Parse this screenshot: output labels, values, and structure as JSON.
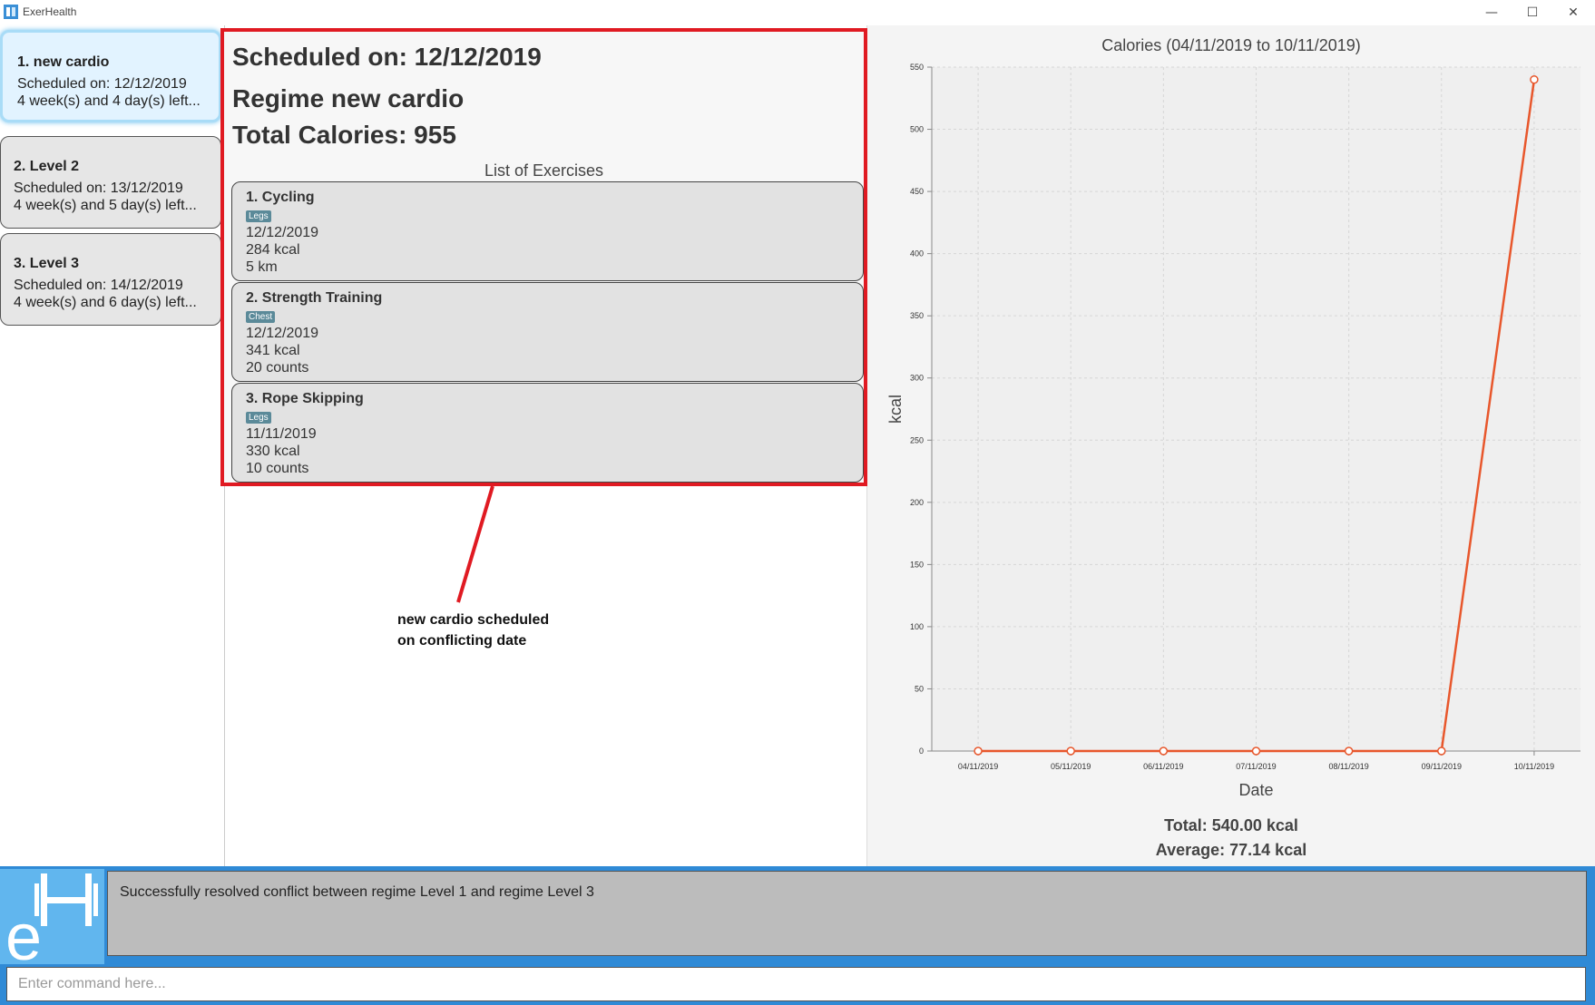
{
  "window": {
    "title": "ExerHealth",
    "minimize": "—",
    "maximize": "☐",
    "close": "✕"
  },
  "regimes": [
    {
      "title": "1.  new cardio",
      "scheduled": "Scheduled on: 12/12/2019",
      "left": "4 week(s) and 4 day(s) left..."
    },
    {
      "title": "2.  Level 2",
      "scheduled": "Scheduled on: 13/12/2019",
      "left": "4 week(s) and 5 day(s) left..."
    },
    {
      "title": "3.  Level 3",
      "scheduled": "Scheduled on: 14/12/2019",
      "left": "4 week(s) and 6 day(s) left..."
    }
  ],
  "detail": {
    "scheduled": "Scheduled on: 12/12/2019",
    "regime": "Regime new cardio",
    "total_calories": "Total Calories: 955",
    "list_header": "List of Exercises",
    "exercises": [
      {
        "name": "1.  Cycling",
        "tag": "Legs",
        "date": "12/12/2019",
        "calories": "284 kcal",
        "quantity": "5 km"
      },
      {
        "name": "2.  Strength Training",
        "tag": "Chest",
        "date": "12/12/2019",
        "calories": "341 kcal",
        "quantity": "20 counts"
      },
      {
        "name": "3.  Rope Skipping",
        "tag": "Legs",
        "date": "11/11/2019",
        "calories": "330 kcal",
        "quantity": "10 counts"
      }
    ]
  },
  "annotation": {
    "line1": "new cardio scheduled",
    "line2": "on conflicting date",
    "color": "#e01a22"
  },
  "chart_data": {
    "type": "line",
    "title": "Calories (04/11/2019 to 10/11/2019)",
    "xlabel": "Date",
    "ylabel": "kcal",
    "categories": [
      "04/11/2019",
      "05/11/2019",
      "06/11/2019",
      "07/11/2019",
      "08/11/2019",
      "09/11/2019",
      "10/11/2019"
    ],
    "values": [
      0,
      0,
      0,
      0,
      0,
      0,
      540
    ],
    "ylim": [
      0,
      550
    ],
    "yticks": [
      0,
      50,
      100,
      150,
      200,
      250,
      300,
      350,
      400,
      450,
      500,
      550
    ],
    "color": "#e8572c",
    "grid": true
  },
  "stats": {
    "total": "Total: 540.00 kcal",
    "average": "Average: 77.14 kcal"
  },
  "result_text": "Successfully resolved conflict between regime Level 1 and regime Level 3",
  "command": {
    "value": "",
    "placeholder": "Enter command here..."
  }
}
